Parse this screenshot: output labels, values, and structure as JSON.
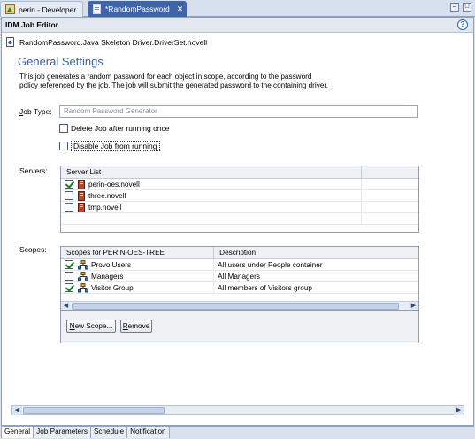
{
  "tabs": [
    {
      "label": "perin - Developer",
      "active": false
    },
    {
      "label": "*RandomPassword",
      "active": true
    }
  ],
  "editor": {
    "title": "IDM Job Editor",
    "path": "RandomPassword.Java Skeleton Driver.DriverSet.novell"
  },
  "general": {
    "title": "General Settings",
    "description_line1": "This job generates a random password for each object in scope, according to the password",
    "description_line2": "policy referenced by the job. The job will submit the generated password to the containing driver."
  },
  "job_type": {
    "label": "Job Type:",
    "value": "Random Password Generator"
  },
  "options": {
    "delete_label": "Delete Job after running once",
    "delete_checked": false,
    "disable_label": "Disable Job from running",
    "disable_checked": false
  },
  "servers": {
    "label": "Servers:",
    "column": "Server List",
    "rows": [
      {
        "name": "perin-oes.novell",
        "checked": true
      },
      {
        "name": "three.novell",
        "checked": false
      },
      {
        "name": "tmp.novell",
        "checked": false
      }
    ]
  },
  "scopes": {
    "label": "Scopes:",
    "columns": [
      "Scopes for PERIN-OES-TREE",
      "Description"
    ],
    "rows": [
      {
        "name": "Provo Users",
        "description": "All users under People container",
        "checked": true
      },
      {
        "name": "Managers",
        "description": "All Managers",
        "checked": false
      },
      {
        "name": "Visitor Group",
        "description": "All members of Visitors group",
        "checked": true
      }
    ],
    "new_scope_label": "New Scope...",
    "remove_label": "Remove"
  },
  "bottom_tabs": [
    {
      "label": "General",
      "active": true
    },
    {
      "label": "Job Parameters",
      "active": false
    },
    {
      "label": "Schedule",
      "active": false
    },
    {
      "label": "Notification",
      "active": false
    }
  ],
  "colors": {
    "accent": "#3a5fa6",
    "active_tab": "#3f64a8",
    "check": "#1d7a1d"
  },
  "icons": [
    "developer-perspective-icon",
    "job-file-icon",
    "help-icon",
    "server-icon",
    "scope-group-icon",
    "minimize-icon",
    "maximize-icon"
  ]
}
